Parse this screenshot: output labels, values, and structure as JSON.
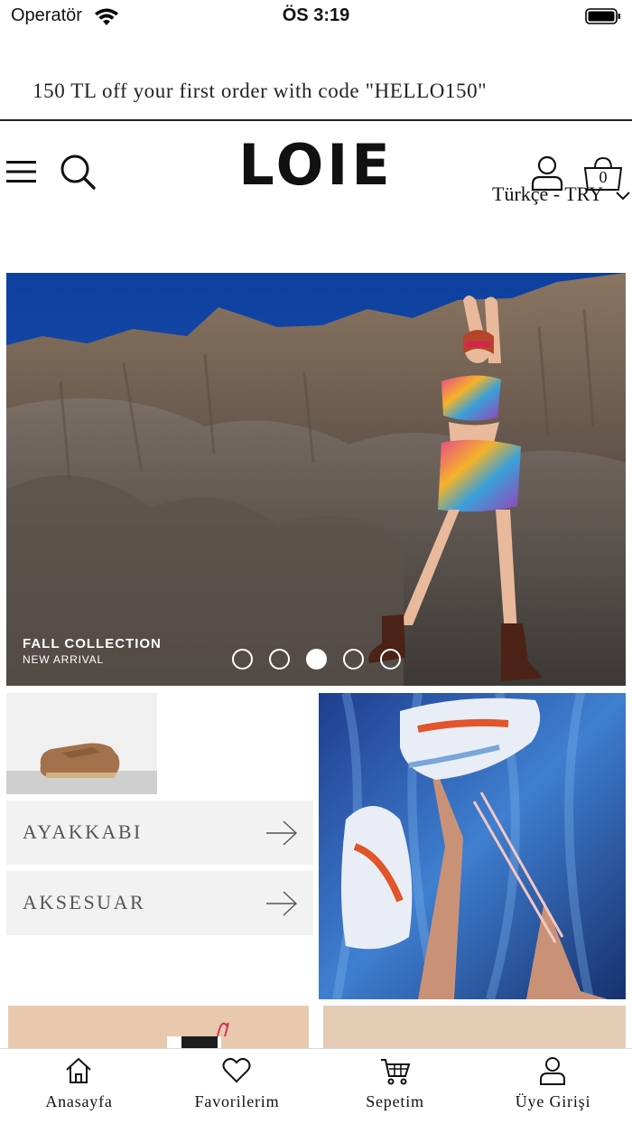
{
  "status_bar": {
    "carrier": "Operatör",
    "time": "ÖS 3:19"
  },
  "promo": {
    "text": "150 TL off your first order with code \"HELLO150\""
  },
  "header": {
    "logo": "LOIE",
    "cart_count": "0",
    "language_currency": "Türkçe - TRY"
  },
  "hero": {
    "title": "FALL COLLECTION",
    "subtitle": "NEW ARRIVAL",
    "slide_count": 5,
    "active_slide": 3
  },
  "categories": [
    {
      "label": "AYAKKABI"
    },
    {
      "label": "AKSESUAR"
    }
  ],
  "tabbar": [
    {
      "label": "Anasayfa",
      "icon": "home-icon"
    },
    {
      "label": "Favorilerim",
      "icon": "heart-icon"
    },
    {
      "label": "Sepetim",
      "icon": "cart-icon"
    },
    {
      "label": "Üye Girişi",
      "icon": "user-icon"
    }
  ]
}
